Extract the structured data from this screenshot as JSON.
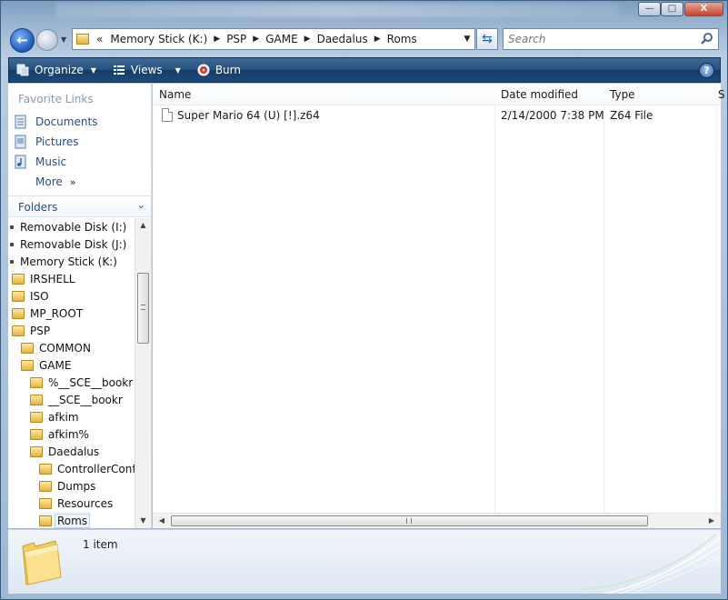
{
  "window": {
    "min_glyph": "—",
    "max_glyph": "□",
    "close_glyph": "X"
  },
  "address": {
    "overflow": "«",
    "crumbs": [
      "Memory Stick (K:)",
      "PSP",
      "GAME",
      "Daedalus",
      "Roms"
    ]
  },
  "search": {
    "placeholder": "Search"
  },
  "toolbar": {
    "organize_label": "Organize",
    "views_label": "Views",
    "burn_label": "Burn",
    "help_glyph": "?"
  },
  "nav": {
    "favorites_header": "Favorite Links",
    "favorites": [
      {
        "label": "Documents",
        "icon": "documents-icon"
      },
      {
        "label": "Pictures",
        "icon": "pictures-icon"
      },
      {
        "label": "Music",
        "icon": "music-icon"
      }
    ],
    "more_label": "More",
    "folders_label": "Folders",
    "tree": [
      {
        "label": "Removable Disk (I:)",
        "depth": 0,
        "type": "drive"
      },
      {
        "label": "Removable Disk (J:)",
        "depth": 0,
        "type": "drive"
      },
      {
        "label": "Memory Stick (K:)",
        "depth": 0,
        "type": "drive"
      },
      {
        "label": "IRSHELL",
        "depth": 1,
        "type": "folder"
      },
      {
        "label": "ISO",
        "depth": 1,
        "type": "folder"
      },
      {
        "label": "MP_ROOT",
        "depth": 1,
        "type": "folder"
      },
      {
        "label": "PSP",
        "depth": 1,
        "type": "folder"
      },
      {
        "label": "COMMON",
        "depth": 2,
        "type": "folder"
      },
      {
        "label": "GAME",
        "depth": 2,
        "type": "folder"
      },
      {
        "label": "%__SCE__bookr",
        "depth": 3,
        "type": "folder"
      },
      {
        "label": "__SCE__bookr",
        "depth": 3,
        "type": "folder"
      },
      {
        "label": "afkim",
        "depth": 3,
        "type": "folder"
      },
      {
        "label": "afkim%",
        "depth": 3,
        "type": "folder"
      },
      {
        "label": "Daedalus",
        "depth": 3,
        "type": "folder"
      },
      {
        "label": "ControllerConfigs",
        "depth": 4,
        "type": "folder"
      },
      {
        "label": "Dumps",
        "depth": 4,
        "type": "folder"
      },
      {
        "label": "Resources",
        "depth": 4,
        "type": "folder"
      },
      {
        "label": "Roms",
        "depth": 4,
        "type": "folder",
        "selected": true
      }
    ]
  },
  "list": {
    "columns": [
      "Name",
      "Date modified",
      "Type",
      "S"
    ],
    "rows": [
      {
        "name": "Super Mario 64 (U) [!].z64",
        "date": "2/14/2000 7:38 PM",
        "type": "Z64 File"
      }
    ]
  },
  "details": {
    "item_count": "1 item"
  },
  "colors": {
    "command_bar": "#26517f",
    "link": "#1e4f8a",
    "folder": "#e4b43c"
  }
}
